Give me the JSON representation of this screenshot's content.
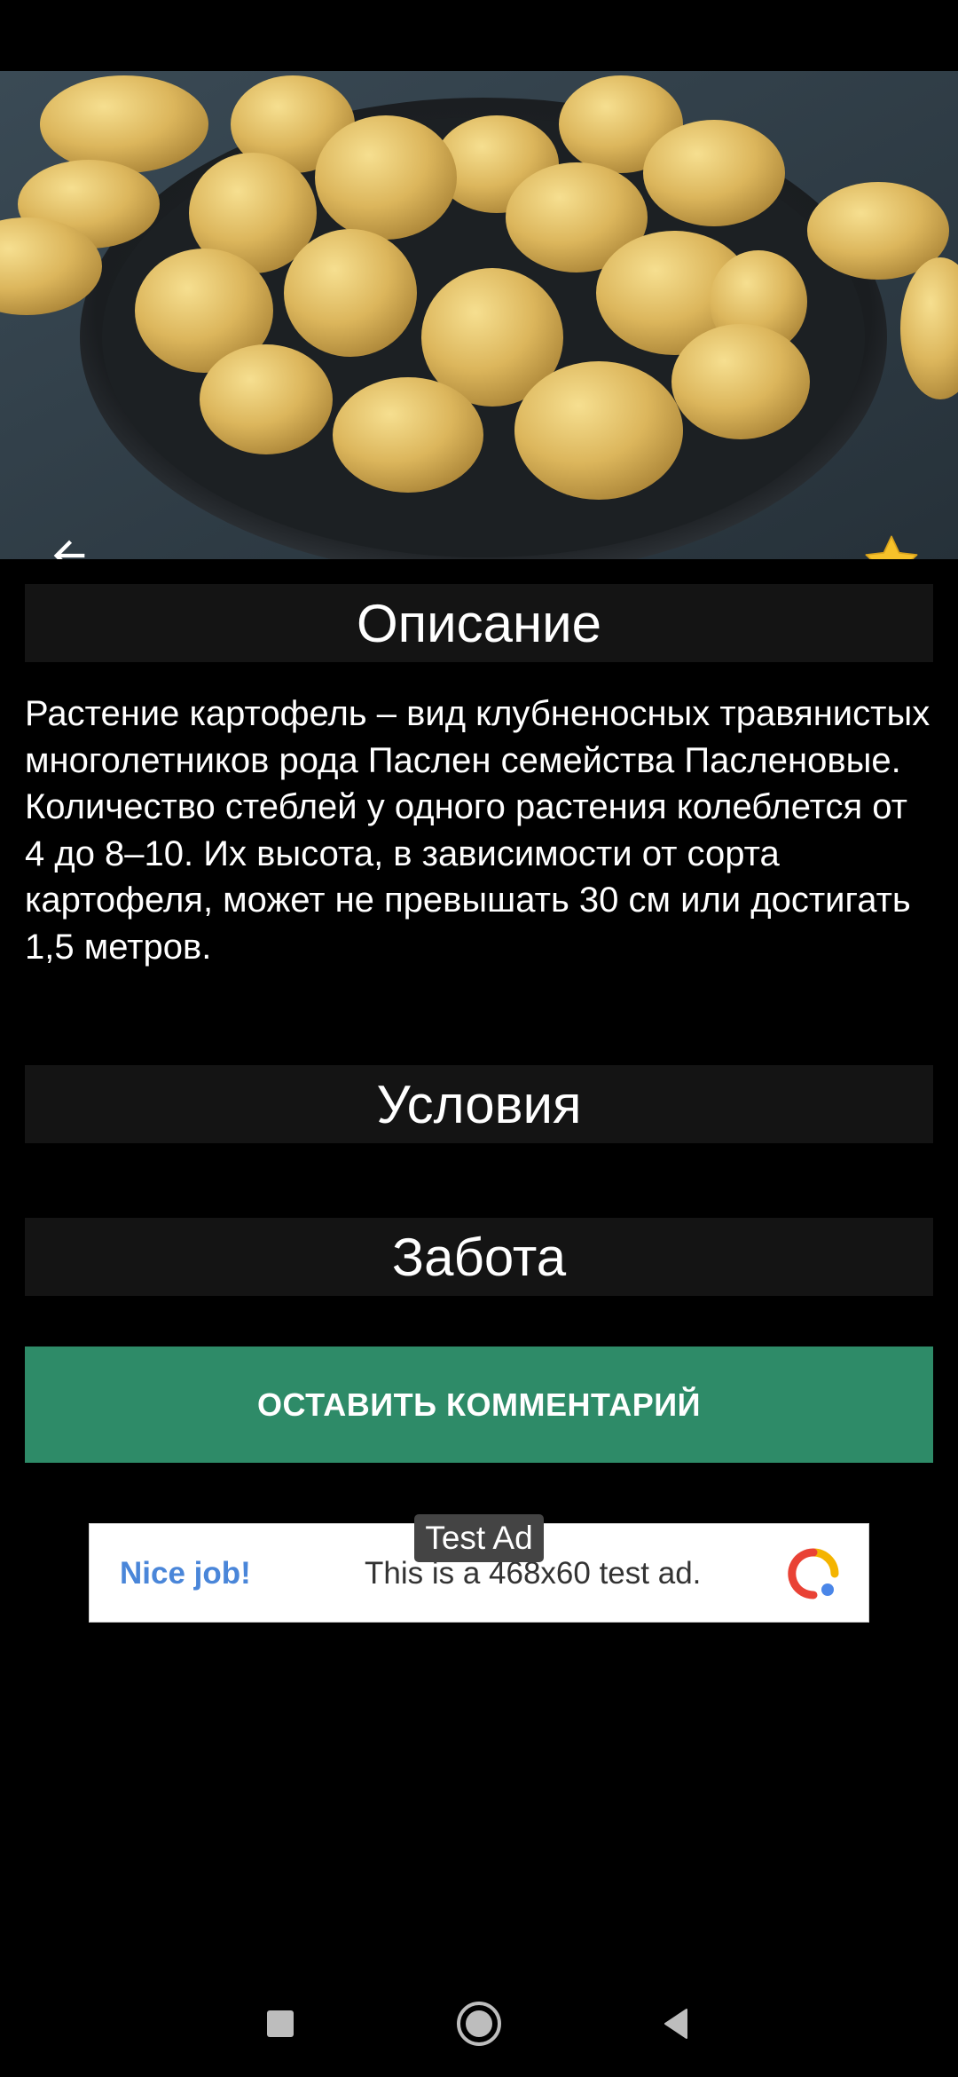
{
  "hero": {
    "image_subject": "potatoes-on-plate",
    "back_icon": "arrow-left-icon",
    "favorite_icon": "star-icon",
    "favorite_color": "#f7c22a"
  },
  "sections": {
    "description_title": "Описание",
    "description_text": "Растение картофель – вид клубненосных травянистых многолетников рода Паслен семейства Пасленовые. Количество стеблей у одного растения колеблется от 4 до 8–10. Их высота, в зависимости от сорта картофеля, может не превышать 30 см или достигать 1,5 метров.",
    "conditions_title": "Условия",
    "care_title": "Забота"
  },
  "actions": {
    "comment_label": "ОСТАВИТЬ КОММЕНТАРИЙ",
    "comment_color": "#2e8b68"
  },
  "ad": {
    "badge": "Test Ad",
    "nice": "Nice job!",
    "text": "This is a 468x60 test ad."
  },
  "nav": {
    "recents_icon": "square-icon",
    "home_icon": "circle-home-icon",
    "back_icon": "triangle-back-icon"
  }
}
